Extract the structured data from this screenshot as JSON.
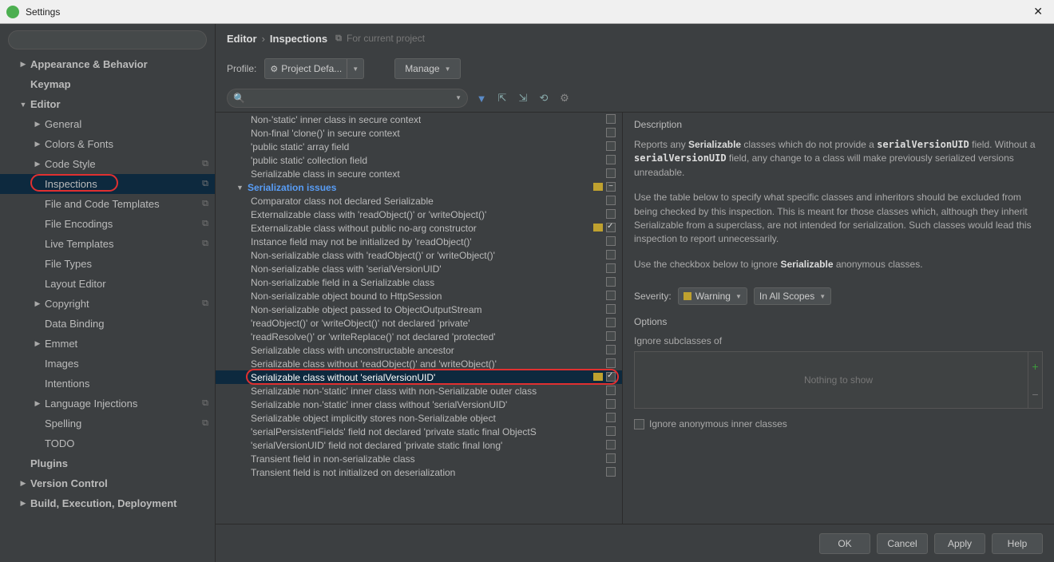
{
  "title": "Settings",
  "crumb": {
    "a": "Editor",
    "b": "Inspections",
    "note": "For current project"
  },
  "profile": {
    "label": "Profile:",
    "value": "Project Defa...",
    "manage": "Manage"
  },
  "sidebar": {
    "items": [
      {
        "label": "Appearance & Behavior",
        "level": 1,
        "arrow": "▶",
        "bold": true
      },
      {
        "label": "Keymap",
        "level": 1,
        "arrow": "",
        "bold": true
      },
      {
        "label": "Editor",
        "level": 1,
        "arrow": "▼",
        "bold": true
      },
      {
        "label": "General",
        "level": 2,
        "arrow": "▶"
      },
      {
        "label": "Colors & Fonts",
        "level": 2,
        "arrow": "▶"
      },
      {
        "label": "Code Style",
        "level": 2,
        "arrow": "▶",
        "badge": "⧉"
      },
      {
        "label": "Inspections",
        "level": 2,
        "arrow": "",
        "sel": true,
        "badge": "⧉",
        "redcircle": true
      },
      {
        "label": "File and Code Templates",
        "level": 2,
        "arrow": "",
        "badge": "⧉"
      },
      {
        "label": "File Encodings",
        "level": 2,
        "arrow": "",
        "badge": "⧉"
      },
      {
        "label": "Live Templates",
        "level": 2,
        "arrow": "",
        "badge": "⧉"
      },
      {
        "label": "File Types",
        "level": 2,
        "arrow": ""
      },
      {
        "label": "Layout Editor",
        "level": 2,
        "arrow": ""
      },
      {
        "label": "Copyright",
        "level": 2,
        "arrow": "▶",
        "badge": "⧉"
      },
      {
        "label": "Data Binding",
        "level": 2,
        "arrow": ""
      },
      {
        "label": "Emmet",
        "level": 2,
        "arrow": "▶"
      },
      {
        "label": "Images",
        "level": 2,
        "arrow": ""
      },
      {
        "label": "Intentions",
        "level": 2,
        "arrow": ""
      },
      {
        "label": "Language Injections",
        "level": 2,
        "arrow": "▶",
        "badge": "⧉"
      },
      {
        "label": "Spelling",
        "level": 2,
        "arrow": "",
        "badge": "⧉"
      },
      {
        "label": "TODO",
        "level": 2,
        "arrow": ""
      },
      {
        "label": "Plugins",
        "level": 1,
        "arrow": "",
        "bold": true
      },
      {
        "label": "Version Control",
        "level": 1,
        "arrow": "▶",
        "bold": true
      },
      {
        "label": "Build, Execution, Deployment",
        "level": 1,
        "arrow": "▶",
        "bold": true
      }
    ]
  },
  "inspections": {
    "pre": [
      "Non-'static' inner class in secure context",
      "Non-final 'clone()' in secure context",
      "'public static' array field",
      "'public static' collection field",
      "Serializable class in secure context"
    ],
    "group": "Serialization issues",
    "list": [
      {
        "t": "Comparator class not declared Serializable"
      },
      {
        "t": "Externalizable class with 'readObject()' or 'writeObject()'"
      },
      {
        "t": "Externalizable class without public no-arg constructor",
        "sev": true,
        "chk": true
      },
      {
        "t": "Instance field may not be initialized by 'readObject()'"
      },
      {
        "t": "Non-serializable class with 'readObject()' or 'writeObject()'"
      },
      {
        "t": "Non-serializable class with 'serialVersionUID'"
      },
      {
        "t": "Non-serializable field in a Serializable class"
      },
      {
        "t": "Non-serializable object bound to HttpSession"
      },
      {
        "t": "Non-serializable object passed to ObjectOutputStream"
      },
      {
        "t": "'readObject()' or 'writeObject()' not declared 'private'"
      },
      {
        "t": "'readResolve()' or 'writeReplace()' not declared 'protected'"
      },
      {
        "t": "Serializable class with unconstructable ancestor"
      },
      {
        "t": "Serializable class without 'readObject()' and 'writeObject()'"
      },
      {
        "t": "Serializable class without 'serialVersionUID'",
        "sel": true,
        "sev": true,
        "chk": true,
        "red": true
      },
      {
        "t": "Serializable non-'static' inner class with non-Serializable outer class"
      },
      {
        "t": "Serializable non-'static' inner class without 'serialVersionUID'"
      },
      {
        "t": "Serializable object implicitly stores non-Serializable object"
      },
      {
        "t": "'serialPersistentFields' field not declared 'private static final ObjectS"
      },
      {
        "t": "'serialVersionUID' field not declared 'private static final long'"
      },
      {
        "t": "Transient field in non-serializable class"
      },
      {
        "t": "Transient field is not initialized on deserialization"
      }
    ]
  },
  "desc": {
    "title": "Description",
    "p1a": "Reports any ",
    "p1b": "Serializable",
    "p1c": " classes which do not provide a ",
    "p1d": "serialVersionUID",
    "p1e": " field. Without a ",
    "p1f": "serialVersionUID",
    "p1g": " field, any change to a class will make previously serialized versions unreadable.",
    "p2": "Use the table below to specify what specific classes and inheritors should be excluded from being checked by this inspection. This is meant for those classes which, although they inherit Serializable from a superclass, are not intended for serialization. Such classes would lead this inspection to report unnecessarily.",
    "p3a": "Use the checkbox below to ignore ",
    "p3b": "Serializable",
    "p3c": " anonymous classes.",
    "sev_label": "Severity:",
    "sev_value": "Warning",
    "scope_value": "In All Scopes",
    "opts_title": "Options",
    "ignore_sub": "Ignore subclasses of",
    "nothing": "Nothing to show",
    "ignore_anon": "Ignore anonymous inner classes"
  },
  "footer": {
    "ok": "OK",
    "cancel": "Cancel",
    "apply": "Apply",
    "help": "Help"
  }
}
